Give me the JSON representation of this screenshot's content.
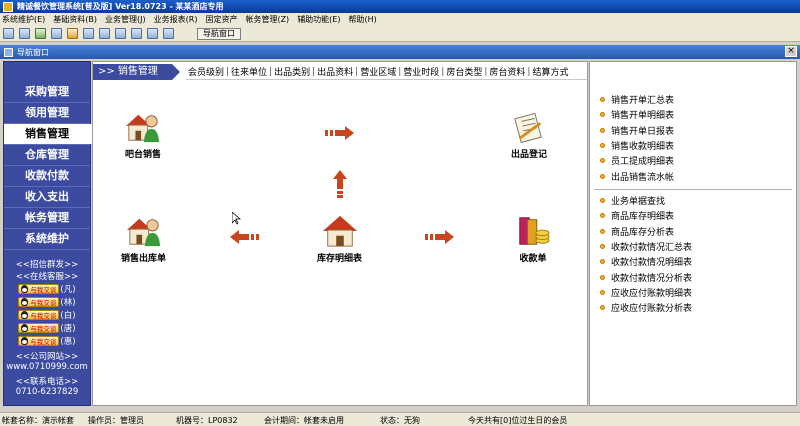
{
  "app": {
    "title": "精诚餐饮管理系统[普及版] Ver18.0723 - 某某酒店专用"
  },
  "menu": [
    "系统维护(E)",
    "基础资料(B)",
    "业务管理(J)",
    "业务报表(R)",
    "固定资产",
    "帐务管理(Z)",
    "辅助功能(E)",
    "帮助(H)"
  ],
  "toolbar": {
    "nav_window_label": "导航窗口"
  },
  "window": {
    "title": "导航窗口",
    "close_glyph": "×"
  },
  "sidebar": {
    "items": [
      "采购管理",
      "领用管理",
      "销售管理",
      "仓库管理",
      "收款付款",
      "收入支出",
      "帐务管理",
      "系统维护"
    ],
    "active_index": 2,
    "recruit": "<<招信群发>>",
    "online": "<<在线客服>>",
    "qq_label": "与我交谈",
    "qq_names": [
      "(凡)",
      "(林)",
      "(白)",
      "(唐)",
      "(惠)"
    ],
    "site_title": "<<公司网站>>",
    "site_url": "www.0710999.com",
    "phone_title": "<<联系电话>>",
    "phone": "0710-6237829"
  },
  "main": {
    "active_tab": ">> 销售管理",
    "tabs": [
      "会员级别",
      "往来单位",
      "出品类别",
      "出品资料",
      "营业区域",
      "营业时段",
      "房台类型",
      "房台资料",
      "结算方式"
    ],
    "modules": {
      "bar_sales": "吧台销售",
      "product_register": "出品登记",
      "sales_out": "销售出库单",
      "inventory": "库存明细表",
      "receipt": "收款单"
    }
  },
  "reports": {
    "group1": [
      "销售开单汇总表",
      "销售开单明细表",
      "销售开单日报表",
      "销售收款明细表",
      "员工提成明细表",
      "出品销售流水帐"
    ],
    "group2": [
      "业务单据查找",
      "商品库存明细表",
      "商品库存分析表",
      "收款付款情况汇总表",
      "收款付款情况明细表",
      "收款付款情况分析表",
      "应收应付账款明细表",
      "应收应付账款分析表"
    ]
  },
  "status": {
    "account": "帐套名称：演示帐套",
    "operator": "操作员：管理员",
    "machine": "机器号：LP0832",
    "period": "会计期间：帐套未启用",
    "state": "状态：无狗",
    "birthday": "今天共有[0]位过生日的会员"
  },
  "colors": {
    "sidebar": "#3c4aa0",
    "title": "#1b5fc8",
    "arrow": "#c8451e"
  }
}
